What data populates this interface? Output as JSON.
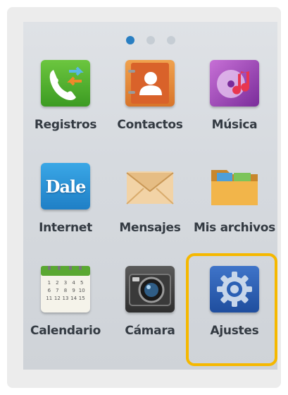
{
  "pager": {
    "pages": 3,
    "active": 0
  },
  "apps": [
    {
      "label": "Registros",
      "icon": "call-log-icon"
    },
    {
      "label": "Contactos",
      "icon": "contacts-icon"
    },
    {
      "label": "Música",
      "icon": "music-icon"
    },
    {
      "label": "Internet",
      "icon": "dale-browser-icon"
    },
    {
      "label": "Mensajes",
      "icon": "envelope-icon"
    },
    {
      "label": "Mis archivos",
      "icon": "folder-icon"
    },
    {
      "label": "Calendario",
      "icon": "calendar-icon"
    },
    {
      "label": "Cámara",
      "icon": "camera-icon"
    },
    {
      "label": "Ajustes",
      "icon": "gear-icon"
    }
  ],
  "dale_text": "Dale",
  "calendar_days": [
    "1",
    "2",
    "3",
    "4",
    "5",
    "6",
    "7",
    "8",
    "9",
    "10",
    "11",
    "12",
    "13",
    "14",
    "15"
  ],
  "highlighted_app": "Ajustes",
  "colors": {
    "highlight": "#f5b800",
    "active_dot": "#2a7fc2"
  }
}
